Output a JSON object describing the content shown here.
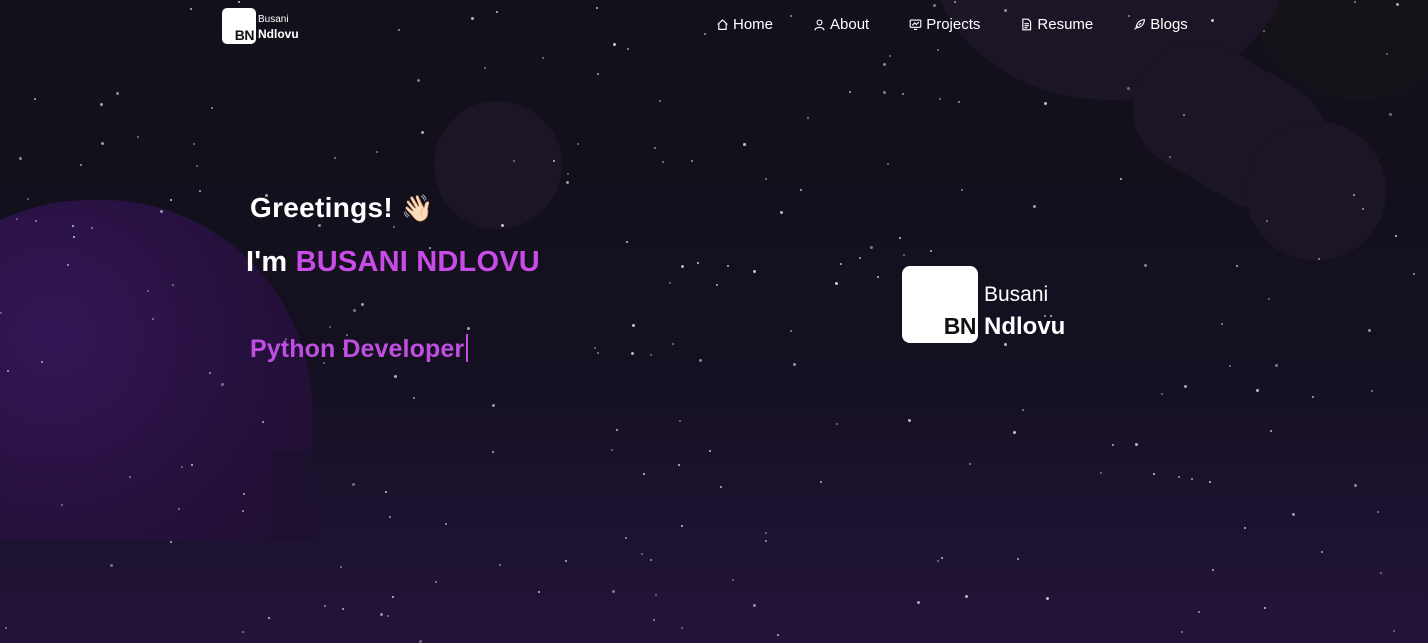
{
  "brand": {
    "initials": "BN",
    "first_name": "Busani",
    "last_name": "Ndlovu"
  },
  "nav": {
    "items": [
      {
        "label": "Home",
        "icon": "home-icon"
      },
      {
        "label": "About",
        "icon": "user-icon"
      },
      {
        "label": "Projects",
        "icon": "projects-icon"
      },
      {
        "label": "Resume",
        "icon": "document-icon"
      },
      {
        "label": "Blogs",
        "icon": "blog-icon"
      }
    ]
  },
  "hero": {
    "greeting": "Greetings!",
    "wave_emoji": "👋🏻",
    "intro_prefix": "I'm ",
    "name": "BUSANI NDLOVU",
    "role": "Python Developer"
  },
  "colors": {
    "background": "#110f17",
    "accent": "#c94be8",
    "role_text": "#bf4fe0",
    "blob": "#321655"
  }
}
